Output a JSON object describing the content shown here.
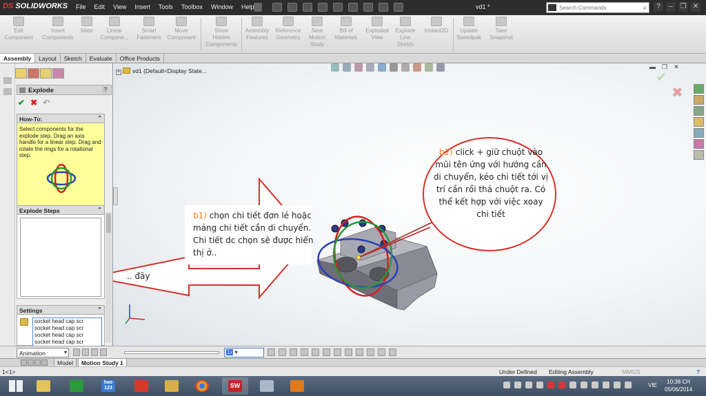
{
  "app": {
    "name": "SOLIDWORKS",
    "document_title": "vd1 *"
  },
  "menu": [
    "File",
    "Edit",
    "View",
    "Insert",
    "Tools",
    "Toolbox",
    "Window",
    "Help"
  ],
  "search": {
    "placeholder": "Search Commands"
  },
  "commands": [
    {
      "line1": "Edit",
      "line2": "Component",
      "line3": ""
    },
    {
      "line1": "Insert",
      "line2": "Components",
      "line3": ""
    },
    {
      "line1": "Mate",
      "line2": "",
      "line3": ""
    },
    {
      "line1": "Linear",
      "line2": "Compone...",
      "line3": ""
    },
    {
      "line1": "Smart",
      "line2": "Fasteners",
      "line3": ""
    },
    {
      "line1": "Move",
      "line2": "Component",
      "line3": ""
    },
    {
      "line1": "Show",
      "line2": "Hidden",
      "line3": "Components"
    },
    {
      "line1": "Assembly",
      "line2": "Features",
      "line3": ""
    },
    {
      "line1": "Reference",
      "line2": "Geometry",
      "line3": ""
    },
    {
      "line1": "New",
      "line2": "Motion",
      "line3": "Study"
    },
    {
      "line1": "Bill of",
      "line2": "Materials",
      "line3": ""
    },
    {
      "line1": "Exploded",
      "line2": "View",
      "line3": ""
    },
    {
      "line1": "Explode",
      "line2": "Line",
      "line3": "Sketch"
    },
    {
      "line1": "Instant3D",
      "line2": "",
      "line3": ""
    },
    {
      "line1": "Update",
      "line2": "Speedpak",
      "line3": ""
    },
    {
      "line1": "Take",
      "line2": "Snapshot",
      "line3": ""
    }
  ],
  "tabs": [
    "Assembly",
    "Layout",
    "Sketch",
    "Evaluate",
    "Office Products"
  ],
  "property_manager": {
    "title": "Explode",
    "help": "?",
    "howto": {
      "header": "How-To:",
      "text": "Select components for the explode step. Drag an axis handle for a linear step. Drag and rotate the rings for a rotational step."
    },
    "explode_steps_header": "Explode Steps",
    "settings_header": "Settings",
    "settings_items": [
      "socket head cap scr",
      "socket head cap scr",
      "socket head cap scr",
      "socket head cap scr"
    ]
  },
  "tree": {
    "root": "vd1  (Default<Display State..."
  },
  "annotations": {
    "b1_label": "b1)",
    "b1_text": " chọn chi tiết đơn lẻ hoặc mảng chi tiết cần di chuyển. Chi tiết dc chọn sẽ được hiển thị ở..",
    "here_text": ".. đây",
    "b2_label": "b2)",
    "b2_text": " click + giữ chuột vào mũi tên ứng với hướng cần di chuyển, kéo chi tiết tới vị trí cần rồi thả chuột ra. Có thể kết hợp với việc xoay chi tiết"
  },
  "animation": {
    "mode": "Animation",
    "speed": "1x"
  },
  "model_tabs": [
    "Model",
    "Motion Study 1"
  ],
  "status": {
    "left": "1<1>",
    "under_defined": "Under Defined",
    "editing": "Editing Assembly",
    "units": "MMGS",
    "help_icon": "?"
  },
  "taskbar": {
    "lang": "VIE",
    "time": "10:38 CH",
    "date": "05/06/2014",
    "hao": "hao\n123"
  },
  "colors": {
    "highlight": "#ff7a1a",
    "arrow_fill": "#ffffff",
    "arrow_stroke": "#d8302a",
    "ring_red": "#d42020",
    "ring_green": "#239a3a",
    "ring_blue": "#2840b8"
  }
}
